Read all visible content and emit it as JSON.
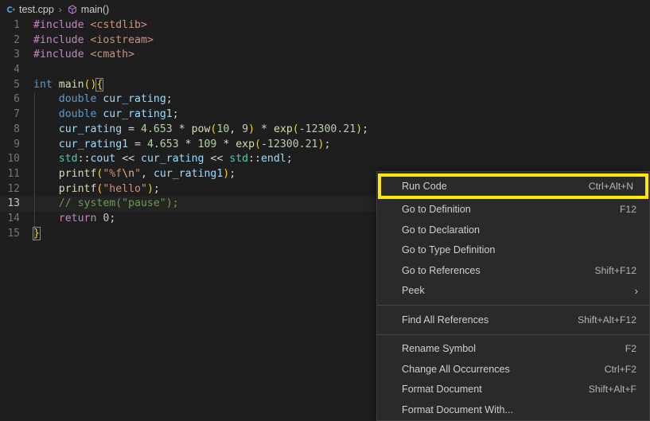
{
  "breadcrumb": {
    "file_icon": "cpp-file-icon",
    "file": "test.cpp",
    "separator": "›",
    "symbol_icon": "symbol-method-icon",
    "symbol": "main()"
  },
  "editor": {
    "active_line": 13,
    "lines": [
      {
        "num": "1",
        "indent": 0
      },
      {
        "num": "2",
        "indent": 0
      },
      {
        "num": "3",
        "indent": 0
      },
      {
        "num": "4",
        "indent": 0
      },
      {
        "num": "5",
        "indent": 0
      },
      {
        "num": "6",
        "indent": 1
      },
      {
        "num": "7",
        "indent": 1
      },
      {
        "num": "8",
        "indent": 1
      },
      {
        "num": "9",
        "indent": 1
      },
      {
        "num": "10",
        "indent": 1
      },
      {
        "num": "11",
        "indent": 1
      },
      {
        "num": "12",
        "indent": 1
      },
      {
        "num": "13",
        "indent": 1
      },
      {
        "num": "14",
        "indent": 1
      },
      {
        "num": "15",
        "indent": 0
      }
    ],
    "source_text": [
      "#include <cstdlib>",
      "#include <iostream>",
      "#include <cmath>",
      "",
      "int main(){",
      "    double cur_rating;",
      "    double cur_rating1;",
      "    cur_rating = 4.653 * pow(10, 9) * exp(-12300.21);",
      "    cur_rating1 = 4.653 * 109 * exp(-12300.21);",
      "    std::cout << cur_rating << std::endl;",
      "    printf(\"%f\\n\", cur_rating1);",
      "    printf(\"hello\");",
      "    // system(\"pause\");",
      "    return 0;",
      "}"
    ]
  },
  "context_menu": {
    "items": [
      {
        "label": "Run Code",
        "keybinding": "Ctrl+Alt+N",
        "highlighted": true,
        "submenu": false
      },
      {
        "label": "Go to Definition",
        "keybinding": "F12",
        "highlighted": false,
        "submenu": false
      },
      {
        "label": "Go to Declaration",
        "keybinding": "",
        "highlighted": false,
        "submenu": false
      },
      {
        "label": "Go to Type Definition",
        "keybinding": "",
        "highlighted": false,
        "submenu": false
      },
      {
        "label": "Go to References",
        "keybinding": "Shift+F12",
        "highlighted": false,
        "submenu": false
      },
      {
        "label": "Peek",
        "keybinding": "",
        "highlighted": false,
        "submenu": true
      },
      {
        "label": "Find All References",
        "keybinding": "Shift+Alt+F12",
        "highlighted": false,
        "submenu": false
      },
      {
        "label": "Rename Symbol",
        "keybinding": "F2",
        "highlighted": false,
        "submenu": false
      },
      {
        "label": "Change All Occurrences",
        "keybinding": "Ctrl+F2",
        "highlighted": false,
        "submenu": false
      },
      {
        "label": "Format Document",
        "keybinding": "Shift+Alt+F",
        "highlighted": false,
        "submenu": false
      },
      {
        "label": "Format Document With...",
        "keybinding": "",
        "highlighted": false,
        "submenu": false
      }
    ],
    "separator_after_indices": [
      5,
      6
    ],
    "chevron_glyph": "›"
  },
  "colors": {
    "editor_background": "#1e1e1e",
    "menu_background": "#2a2a2a",
    "highlight_border": "#ffe800",
    "active_line_background": "#242424",
    "preprocessor": "#c586c0",
    "string": "#ce9178",
    "keyword": "#569cd6",
    "type": "#4ec9b0",
    "variable": "#9cdcfe",
    "number": "#b5cea8",
    "function": "#dcdcaa",
    "comment": "#6a9955",
    "bracket_yellow": "#ffd700",
    "bracket_magenta": "#da70d6",
    "line_number": "#6e7681",
    "foreground": "#d4d4d4"
  }
}
